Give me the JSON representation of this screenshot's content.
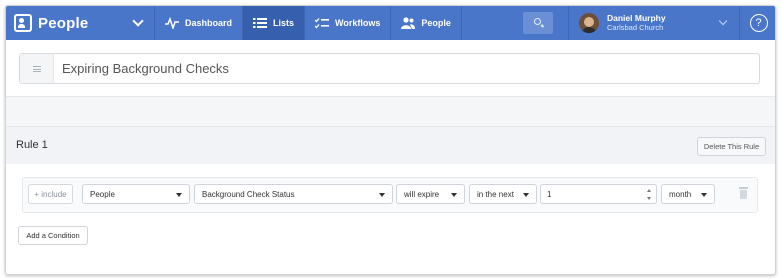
{
  "nav": {
    "app_title": "People",
    "items": [
      {
        "label": "Dashboard",
        "icon": "pulse-icon"
      },
      {
        "label": "Lists",
        "icon": "list-icon",
        "active": true
      },
      {
        "label": "Workflows",
        "icon": "workflow-icon"
      },
      {
        "label": "People",
        "icon": "people-icon"
      }
    ],
    "user": {
      "name": "Daniel Murphy",
      "org": "Carlsbad Church"
    },
    "help_label": "?"
  },
  "list": {
    "name": "Expiring Background Checks"
  },
  "rule": {
    "title": "Rule 1",
    "delete_label": "Delete This Rule",
    "condition": {
      "include_label": "+ include",
      "subject": "People",
      "field": "Background Check Status",
      "operator": "will expire",
      "range": "in the next",
      "amount": "1",
      "unit": "month"
    },
    "add_condition_label": "Add a Condition"
  },
  "colors": {
    "nav_bg": "#4a76c9",
    "nav_active": "#3660ad",
    "page_bg": "#f5f6f8"
  }
}
